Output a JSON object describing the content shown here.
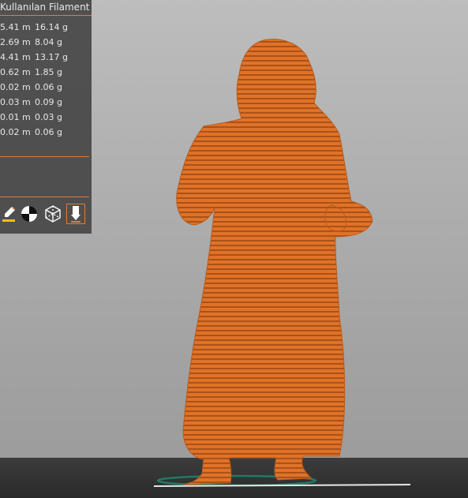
{
  "panel": {
    "title": "Kullanılan Filament",
    "rows": [
      {
        "length": "5.41 m",
        "weight": "16.14 g"
      },
      {
        "length": "2.69 m",
        "weight": "8.04 g"
      },
      {
        "length": "4.41 m",
        "weight": "13.17 g"
      },
      {
        "length": "0.62 m",
        "weight": "1.85 g"
      },
      {
        "length": "0.02 m",
        "weight": "0.06 g"
      },
      {
        "length": "0.03 m",
        "weight": "0.09 g"
      },
      {
        "length": "0.01 m",
        "weight": "0.03 g"
      },
      {
        "length": "0.02 m",
        "weight": "0.06 g"
      }
    ]
  },
  "toolbar": {
    "icons": [
      "paint-brush-icon",
      "color-wheel-icon",
      "wireframe-cube-icon",
      "support-export-icon"
    ]
  },
  "colors": {
    "accent": "#e07b39",
    "model": "#e07227",
    "panel_bg": "#464646"
  }
}
